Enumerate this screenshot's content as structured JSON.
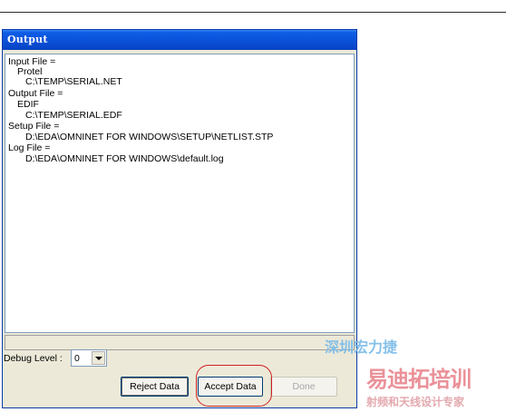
{
  "window": {
    "title": "Output"
  },
  "output": {
    "lines": [
      "Input File =",
      "Protel",
      "C:\\TEMP\\SERIAL.NET",
      "Output File =",
      "EDIF",
      "C:\\TEMP\\SERIAL.EDF",
      "Setup File =",
      "D:\\EDA\\OMNINET FOR WINDOWS\\SETUP\\NETLIST.STP",
      "Log File =",
      "D:\\EDA\\OMNINET FOR WINDOWS\\default.log"
    ]
  },
  "debug": {
    "label": "Debug Level :",
    "value": "0"
  },
  "buttons": {
    "reject": "Reject Data",
    "accept": "Accept Data",
    "done": "Done"
  },
  "watermark": {
    "line1": "深圳宏力捷",
    "line2": "易迪拓培训",
    "line3": "射频和天线设计专家"
  },
  "colors": {
    "titlebar": "#0a4fd6",
    "highlight": "#d02020"
  }
}
